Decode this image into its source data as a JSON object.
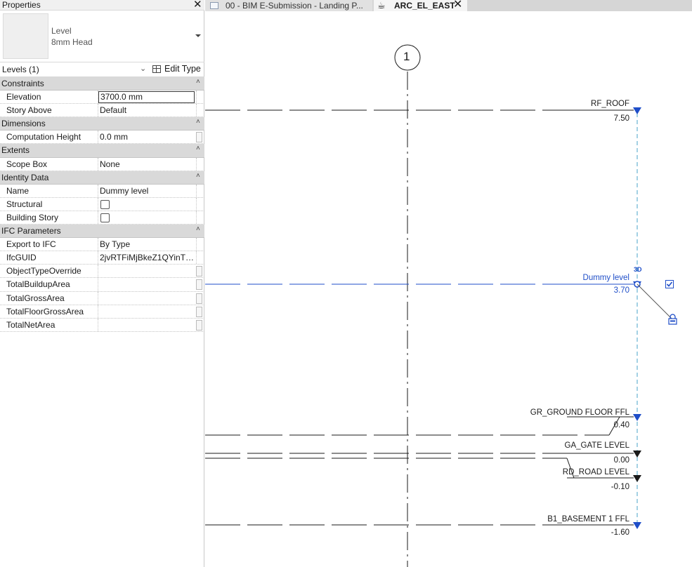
{
  "properties": {
    "title": "Properties",
    "close": "✕",
    "type_selector": {
      "family": "Level",
      "type": "8mm Head"
    },
    "filter": "Levels (1)",
    "edit_type": "Edit Type",
    "groups": [
      {
        "name": "Constraints",
        "rows": [
          {
            "name": "Elevation",
            "value": "3700.0 mm",
            "kind": "edit"
          },
          {
            "name": "Story Above",
            "value": "Default",
            "kind": "text"
          }
        ]
      },
      {
        "name": "Dimensions",
        "rows": [
          {
            "name": "Computation Height",
            "value": "0.0 mm",
            "kind": "text",
            "btn": true
          }
        ]
      },
      {
        "name": "Extents",
        "rows": [
          {
            "name": "Scope Box",
            "value": "None",
            "kind": "text"
          }
        ]
      },
      {
        "name": "Identity Data",
        "rows": [
          {
            "name": "Name",
            "value": "Dummy level",
            "kind": "text"
          },
          {
            "name": "Structural",
            "value": false,
            "kind": "check"
          },
          {
            "name": "Building Story",
            "value": false,
            "kind": "check"
          }
        ]
      },
      {
        "name": "IFC Parameters",
        "rows": [
          {
            "name": "Export to IFC",
            "value": "By Type",
            "kind": "text"
          },
          {
            "name": "IfcGUID",
            "value": "2jvRTFiMjBkeZ1QYinTp...",
            "kind": "text"
          },
          {
            "name": "ObjectTypeOverride",
            "value": "",
            "kind": "text",
            "btn": true
          },
          {
            "name": "TotalBuildupArea",
            "value": "",
            "kind": "text",
            "btn": true
          },
          {
            "name": "TotalGrossArea",
            "value": "",
            "kind": "text",
            "btn": true
          },
          {
            "name": "TotalFloorGrossArea",
            "value": "",
            "kind": "text",
            "btn": true
          },
          {
            "name": "TotalNetArea",
            "value": "",
            "kind": "text",
            "btn": true
          }
        ]
      }
    ]
  },
  "tabs": [
    {
      "label": "00 - BIM E-Submission - Landing P...",
      "active": false
    },
    {
      "label": "ARC_EL_EAST",
      "active": true,
      "close": "✕"
    }
  ],
  "view": {
    "grid_bubble": "1",
    "dummy_level_3d": "3D",
    "levels": [
      {
        "name": "RF_ROOF",
        "elevation": "7.50",
        "selected": false
      },
      {
        "name": "Dummy level",
        "elevation": "3.70",
        "selected": true
      },
      {
        "name": "GR_GROUND FLOOR FFL",
        "elevation": "0.40",
        "selected": false
      },
      {
        "name": "GA_GATE LEVEL",
        "elevation": "0.00",
        "selected": false
      },
      {
        "name": "RD_ROAD LEVEL",
        "elevation": "-0.10",
        "selected": false
      },
      {
        "name": "B1_BASEMENT 1 FFL",
        "elevation": "-1.60",
        "selected": false
      }
    ],
    "colors": {
      "selected": "#1f4ec8",
      "line": "#1a1a1a",
      "grid_dash": "#4aa3c8"
    }
  }
}
